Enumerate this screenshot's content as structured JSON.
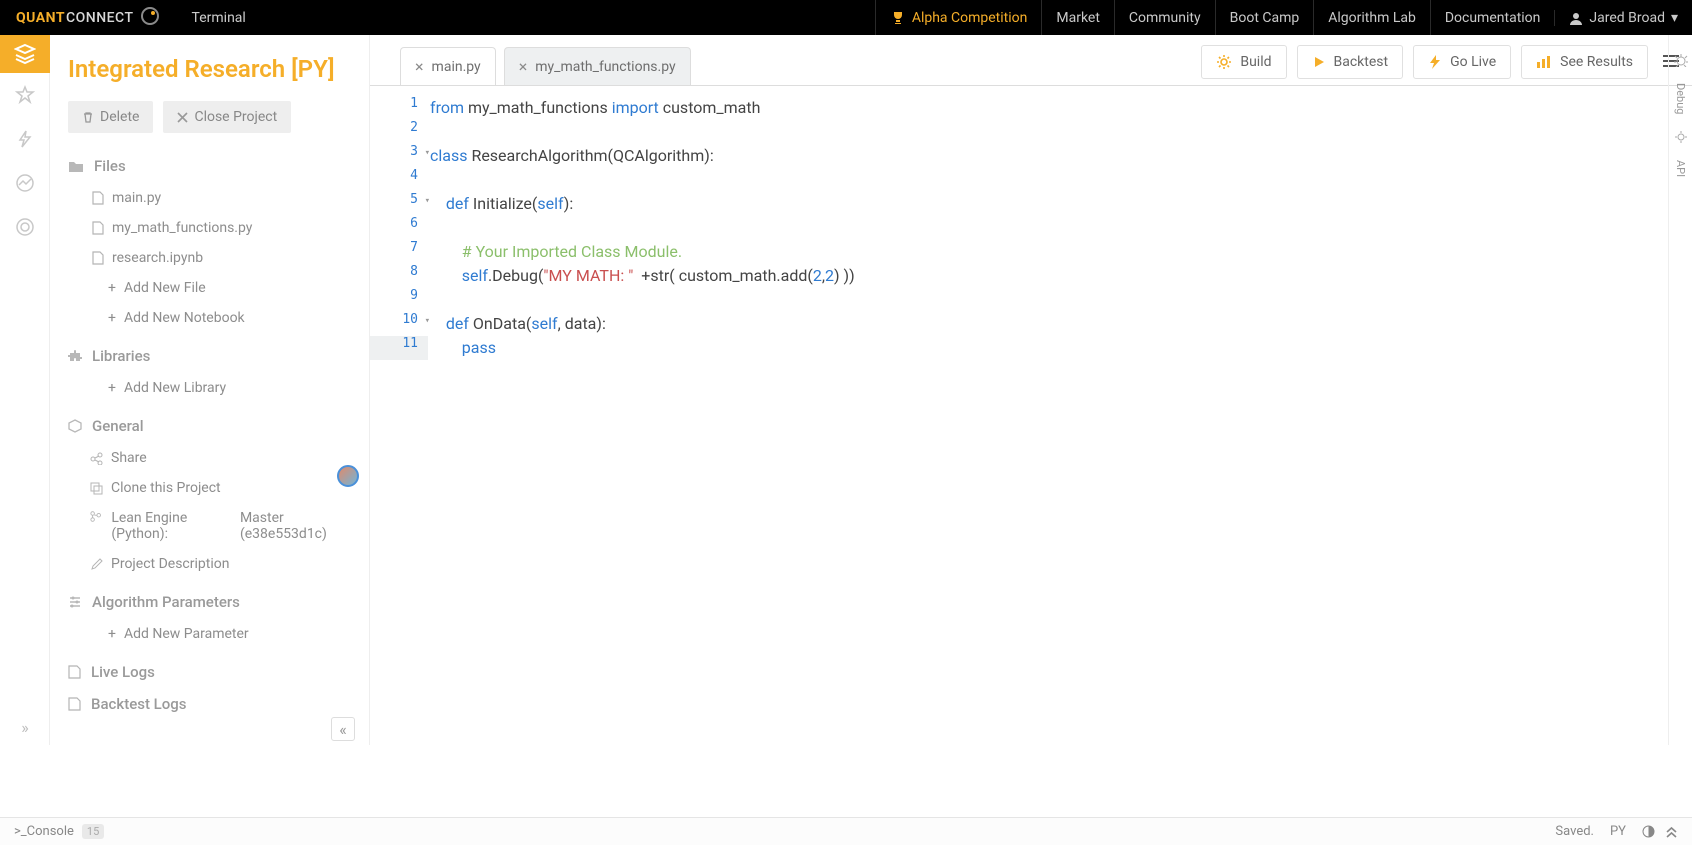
{
  "topbar": {
    "brand_a": "QUANT",
    "brand_b": "CONNECT",
    "title": "Terminal",
    "nav": {
      "alpha": "Alpha Competition",
      "market": "Market",
      "community": "Community",
      "bootcamp": "Boot Camp",
      "algolab": "Algorithm Lab",
      "docs": "Documentation"
    },
    "user": "Jared Broad"
  },
  "sidebar": {
    "project_title": "Integrated Research [PY]",
    "delete_label": "Delete",
    "close_label": "Close Project",
    "files_head": "Files",
    "files": [
      "main.py",
      "my_math_functions.py",
      "research.ipynb"
    ],
    "add_file": "Add New File",
    "add_notebook": "Add New Notebook",
    "libraries_head": "Libraries",
    "add_library": "Add New Library",
    "general_head": "General",
    "share": "Share",
    "clone": "Clone this Project",
    "lean_label": "Lean Engine (Python):",
    "lean_val": "Master (e38e553d1c)",
    "project_desc": "Project Description",
    "params_head": "Algorithm Parameters",
    "add_param": "Add New Parameter",
    "live_logs": "Live Logs",
    "backtest_logs": "Backtest Logs"
  },
  "tabs": {
    "active": "main.py",
    "inactive": "my_math_functions.py"
  },
  "actions": {
    "build": "Build",
    "backtest": "Backtest",
    "golive": "Go Live",
    "results": "See Results"
  },
  "code": {
    "lines": [
      {
        "n": 1,
        "fold": false
      },
      {
        "n": 2,
        "fold": false
      },
      {
        "n": 3,
        "fold": true
      },
      {
        "n": 4,
        "fold": false
      },
      {
        "n": 5,
        "fold": true
      },
      {
        "n": 6,
        "fold": false
      },
      {
        "n": 7,
        "fold": false
      },
      {
        "n": 8,
        "fold": false
      },
      {
        "n": 9,
        "fold": false
      },
      {
        "n": 10,
        "fold": true
      },
      {
        "n": 11,
        "fold": false,
        "hl": true
      }
    ],
    "l1_from": "from",
    "l1_mod": " my_math_functions ",
    "l1_import": "import",
    "l1_name": " custom_math",
    "l3_class": "class",
    "l3_rest": " ResearchAlgorithm(QCAlgorithm):",
    "l5_def": "    def",
    "l5_name": " Initialize(",
    "l5_self": "self",
    "l5_end": "):",
    "l7_comment": "        # Your Imported Class Module.",
    "l8_self": "        self",
    "l8_debug": ".Debug(",
    "l8_str": "\"MY MATH: \"",
    "l8_mid": "  +str( custom_math.add(",
    "l8_n1": "2",
    "l8_c": ",",
    "l8_n2": "2",
    "l8_end": ") ))",
    "l10_def": "    def",
    "l10_name": " OnData(",
    "l10_self": "self",
    "l10_rest": ", data):",
    "l11_pass": "        pass"
  },
  "right_rail": {
    "debug": "Debug",
    "api": "API"
  },
  "status": {
    "console": ">_Console",
    "badge": "15",
    "saved": "Saved.",
    "lang": "PY"
  }
}
